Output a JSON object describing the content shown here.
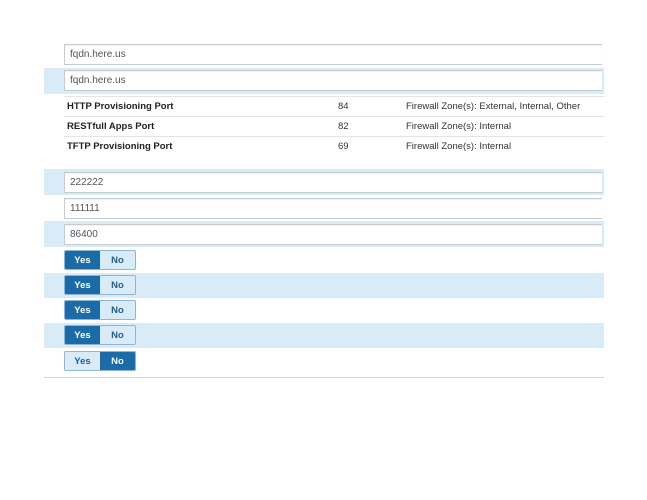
{
  "fields": {
    "fqdn_primary": "fqdn.here.us",
    "fqdn_secondary": "fqdn.here.us"
  },
  "ports": [
    {
      "name": "HTTP Provisioning Port",
      "port": "84",
      "zones": "Firewall Zone(s): External, Internal, Other"
    },
    {
      "name": "RESTfull Apps Port",
      "port": "82",
      "zones": "Firewall Zone(s): Internal"
    },
    {
      "name": "TFTP Provisioning Port",
      "port": "69",
      "zones": "Firewall Zone(s): Internal"
    }
  ],
  "numeric_fields": {
    "field_1": "222222",
    "field_2": "111111",
    "field_3": "86400"
  },
  "toggle_labels": {
    "yes": "Yes",
    "no": "No"
  },
  "toggles": [
    {
      "selected": "Yes"
    },
    {
      "selected": "Yes"
    },
    {
      "selected": "Yes"
    },
    {
      "selected": "Yes"
    },
    {
      "selected": "No"
    }
  ],
  "colors": {
    "accent": "#1a6ba7",
    "row_alt": "#d9ebf7"
  }
}
